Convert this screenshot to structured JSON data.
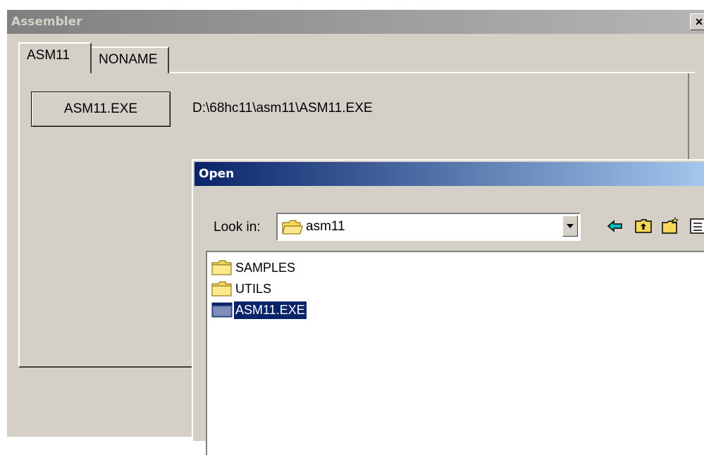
{
  "window": {
    "title": "Assembler",
    "close_glyph": "×"
  },
  "tabs": [
    {
      "label": "ASM11",
      "active": true
    },
    {
      "label": "NONAME",
      "active": false
    }
  ],
  "panel": {
    "button_label": "ASM11.EXE",
    "path_text": "D:\\68hc11\\asm11\\ASM11.EXE"
  },
  "open_dialog": {
    "title": "Open",
    "look_in_label": "Look in:",
    "look_in_value": "asm11",
    "toolbar_icons": [
      "back-arrow-icon",
      "up-folder-icon",
      "new-folder-icon",
      "view-menu-icon"
    ],
    "files": [
      {
        "name": "SAMPLES",
        "icon": "folder-icon",
        "selected": false
      },
      {
        "name": "UTILS",
        "icon": "folder-icon",
        "selected": false
      },
      {
        "name": "ASM11.EXE",
        "icon": "exe-file-icon",
        "selected": true
      }
    ]
  },
  "colors": {
    "face": "#d4d0c8",
    "active_title": "#0a246a",
    "inactive_title": "#808080",
    "selection": "#0a246a",
    "folder_yellow": "#f5d85a"
  }
}
